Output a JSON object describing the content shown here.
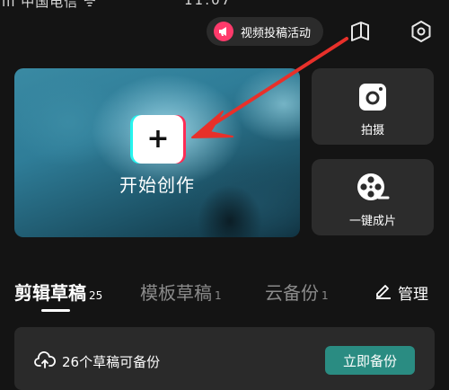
{
  "status_bar": {
    "left_text": "ııı 中国电信 ᯤ",
    "center_text": "11:07"
  },
  "top_bar": {
    "promo_label": "视频投稿活动",
    "icons": [
      "megaphone-icon",
      "book-icon",
      "settings-icon"
    ]
  },
  "hero": {
    "create_label": "开始创作",
    "plus_symbol": "+"
  },
  "side_cards": [
    {
      "label": "拍摄",
      "icon": "camera-icon"
    },
    {
      "label": "一键成片",
      "icon": "film-reel-icon"
    }
  ],
  "tabs": [
    {
      "label": "剪辑草稿",
      "count": "25",
      "active": true
    },
    {
      "label": "模板草稿",
      "count": "1",
      "active": false
    },
    {
      "label": "云备份",
      "count": "1",
      "active": false
    }
  ],
  "manage_label": "管理",
  "backup": {
    "message": "26个草稿可备份",
    "button_label": "立即备份"
  },
  "colors": {
    "accent": "#fe2c55",
    "teal": "#2a8c82",
    "annotation": "#e8302a"
  }
}
